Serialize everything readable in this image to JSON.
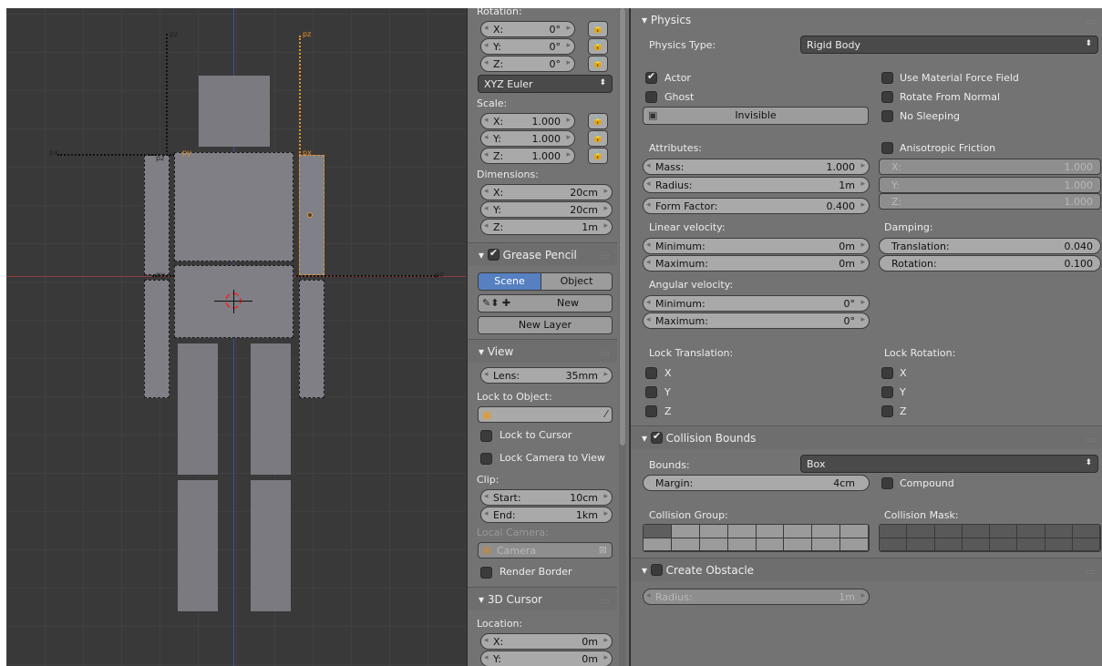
{
  "viewport": {
    "bone_labels": {
      "pz_a": "pz",
      "pz_b": "pz",
      "px_a": "px",
      "py_a": "py",
      "pz_c": "pz",
      "px_b": "px",
      "py_b": "py",
      "px_c": "px"
    }
  },
  "npanel": {
    "rotation": {
      "label": "Rotation:",
      "x": {
        "l": "X:",
        "v": "0°"
      },
      "y": {
        "l": "Y:",
        "v": "0°"
      },
      "z": {
        "l": "Z:",
        "v": "0°"
      },
      "mode": "XYZ Euler"
    },
    "scale": {
      "label": "Scale:",
      "x": {
        "l": "X:",
        "v": "1.000"
      },
      "y": {
        "l": "Y:",
        "v": "1.000"
      },
      "z": {
        "l": "Z:",
        "v": "1.000"
      }
    },
    "dimensions": {
      "label": "Dimensions:",
      "x": {
        "l": "X:",
        "v": "20cm"
      },
      "y": {
        "l": "Y:",
        "v": "20cm"
      },
      "z": {
        "l": "Z:",
        "v": "1m"
      }
    },
    "grease_pencil": {
      "title": "Grease Pencil",
      "scene": "Scene",
      "object": "Object",
      "new": "New",
      "new_layer": "New Layer"
    },
    "view": {
      "title": "View",
      "lens_l": "Lens:",
      "lens_v": "35mm",
      "lock_object": "Lock to Object:",
      "lock_cursor": "Lock to Cursor",
      "lock_camera": "Lock Camera to View",
      "clip": "Clip:",
      "start_l": "Start:",
      "start_v": "10cm",
      "end_l": "End:",
      "end_v": "1km",
      "local_camera": "Local Camera:",
      "camera": "Camera",
      "render_border": "Render Border"
    },
    "cursor": {
      "title": "3D Cursor",
      "location": "Location:",
      "x": {
        "l": "X:",
        "v": "0m"
      },
      "y": {
        "l": "Y:",
        "v": "0m"
      }
    }
  },
  "physics": {
    "title": "Physics",
    "type_label": "Physics Type:",
    "type_value": "Rigid Body",
    "actor": "Actor",
    "ghost": "Ghost",
    "invisible": "Invisible",
    "use_mat_force": "Use Material Force Field",
    "rotate_normal": "Rotate From Normal",
    "no_sleeping": "No Sleeping",
    "attributes": "Attributes:",
    "mass": {
      "l": "Mass:",
      "v": "1.000"
    },
    "radius": {
      "l": "Radius:",
      "v": "1m"
    },
    "form_factor": {
      "l": "Form Factor:",
      "v": "0.400"
    },
    "aniso": "Anisotropic Friction",
    "ax": {
      "l": "X:",
      "v": "1.000"
    },
    "ay": {
      "l": "Y:",
      "v": "1.000"
    },
    "az": {
      "l": "Z:",
      "v": "1.000"
    },
    "linear": "Linear velocity:",
    "lin_min": {
      "l": "Minimum:",
      "v": "0m"
    },
    "lin_max": {
      "l": "Maximum:",
      "v": "0m"
    },
    "damping": "Damping:",
    "translation": {
      "l": "Translation:",
      "v": "0.040"
    },
    "rotation": {
      "l": "Rotation:",
      "v": "0.100"
    },
    "angular": "Angular velocity:",
    "ang_min": {
      "l": "Minimum:",
      "v": "0°"
    },
    "ang_max": {
      "l": "Maximum:",
      "v": "0°"
    },
    "lock_trans": "Lock Translation:",
    "lock_rot": "Lock Rotation:",
    "x": "X",
    "y": "Y",
    "z": "Z"
  },
  "collision": {
    "title": "Collision Bounds",
    "bounds_label": "Bounds:",
    "bounds_value": "Box",
    "margin": {
      "l": "Margin:",
      "v": "4cm"
    },
    "compound": "Compound",
    "group": "Collision Group:",
    "mask": "Collision Mask:"
  },
  "obstacle": {
    "title": "Create Obstacle",
    "radius": {
      "l": "Radius:",
      "v": "1m"
    }
  }
}
